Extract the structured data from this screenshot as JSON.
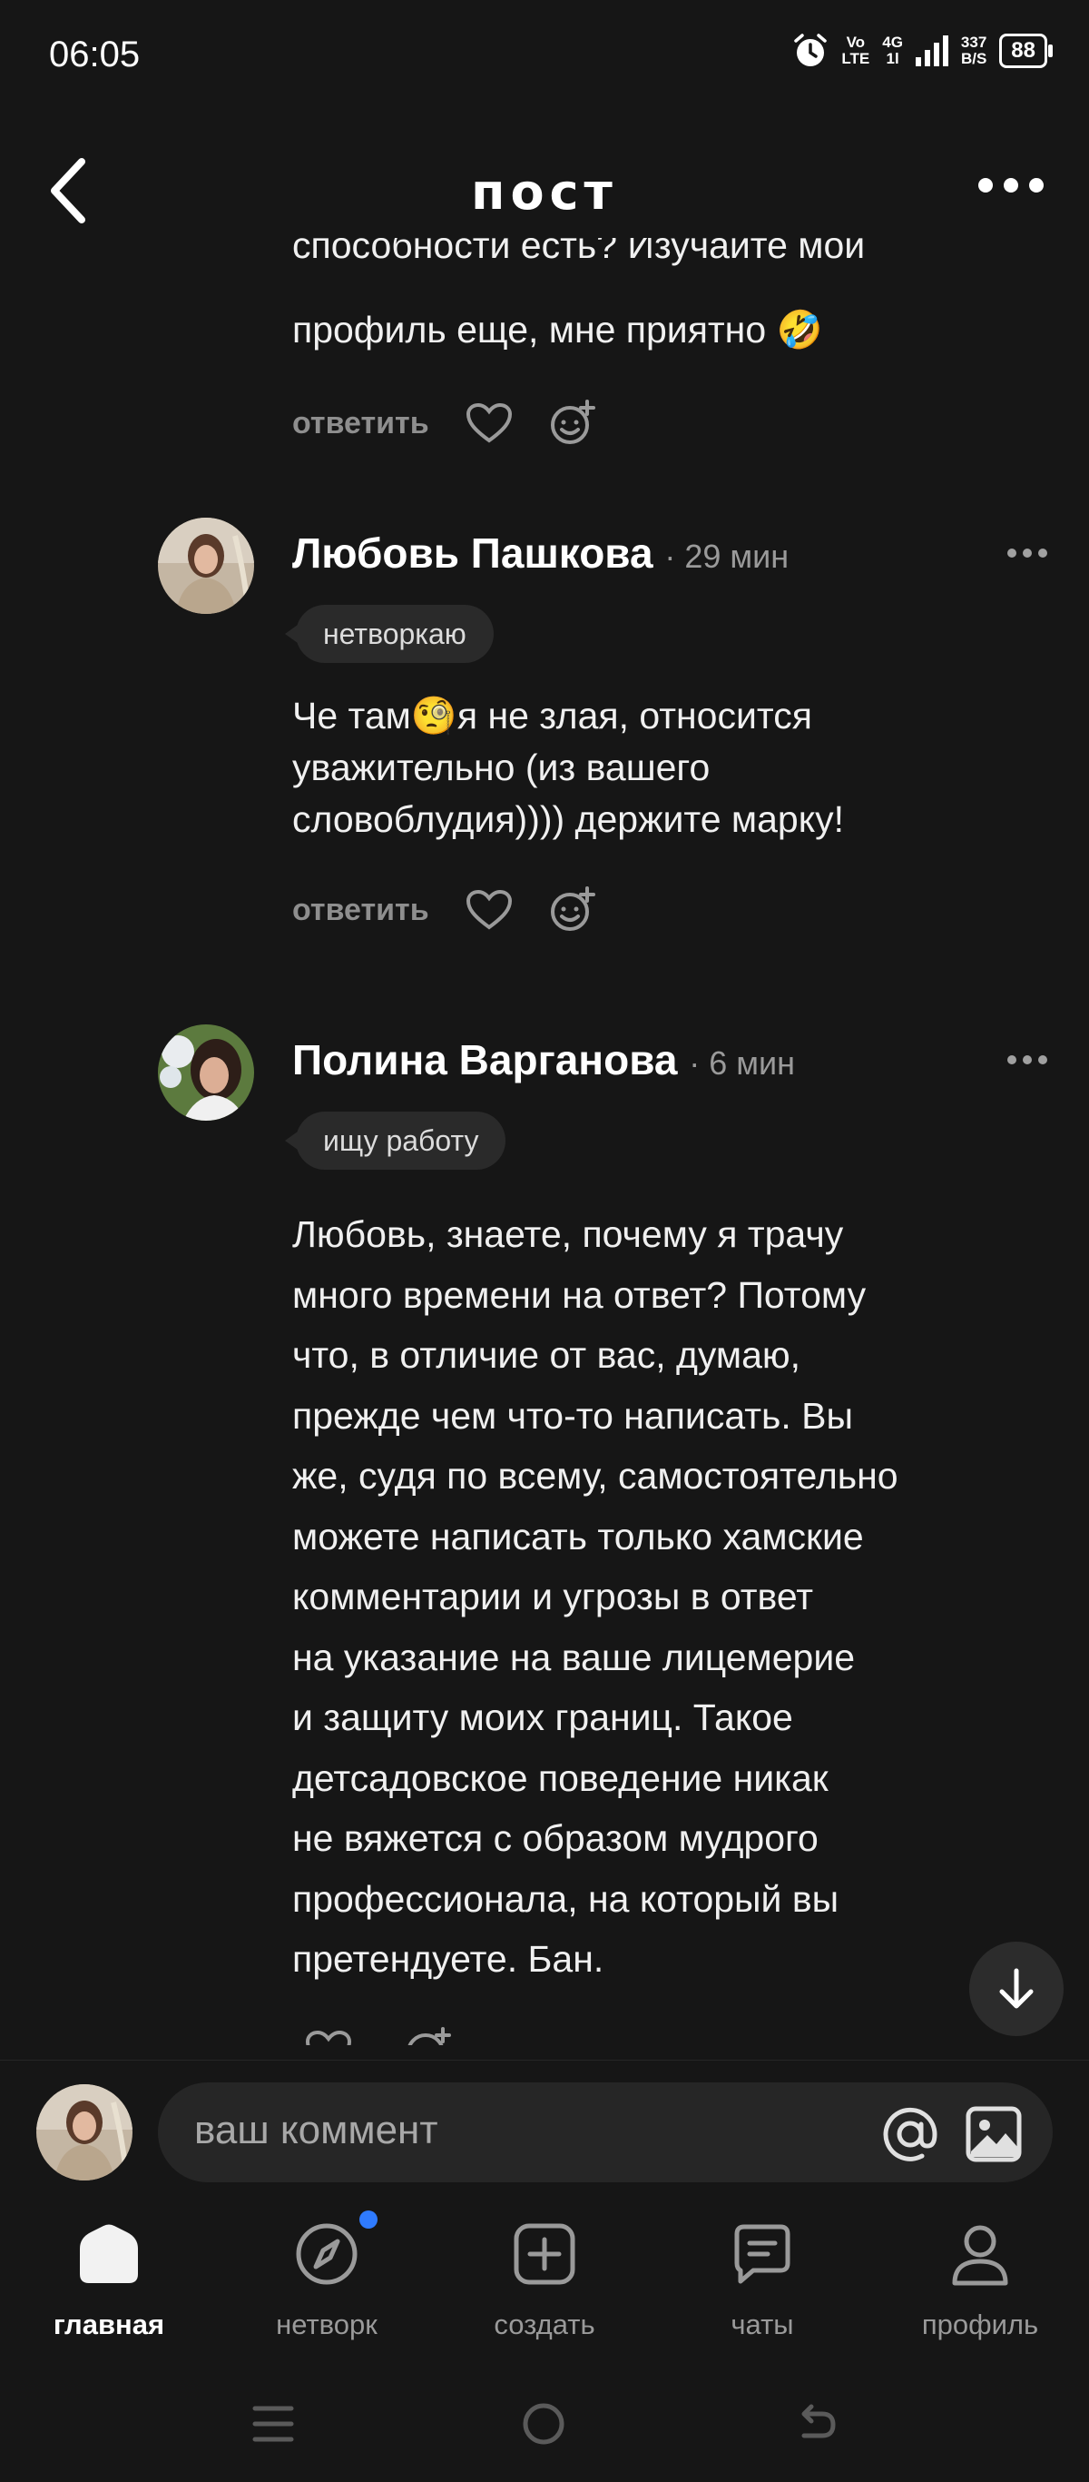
{
  "status_bar": {
    "time": "06:05",
    "volte_top": "Vo",
    "volte_bottom": "LTE",
    "network_top": "4G",
    "network_bottom": "1l",
    "speed_top": "337",
    "speed_bottom": "B/S",
    "battery": "88"
  },
  "header": {
    "title": "пост"
  },
  "partial_comment": {
    "text_line1": "способности есть? Изучайте мой",
    "text_line2": "профиль еще, мне приятно 🤣",
    "reply_label": "ответить"
  },
  "comments": [
    {
      "author": "Любовь Пашкова",
      "time": "· 29 мин",
      "tag": "нетворкаю",
      "lines": [
        "Че там🧐я не злая, относится",
        "уважительно (из вашего",
        "словоблудия)))) держите марку!"
      ],
      "reply_label": "ответить"
    },
    {
      "author": "Полина Варганова",
      "time": "· 6 мин",
      "tag": "ищу работу",
      "lines": [
        "Любовь, знаете, почему я трачу",
        "много времени на ответ? Потому",
        "что, в отличие от вас, думаю,",
        "прежде чем что-то написать. Вы",
        "же, судя по всему, самостоятельно",
        "можете написать только хамские",
        "комментарии и угрозы в ответ",
        "на указание на ваше лицемерие",
        "и защиту моих границ. Такое",
        "детсадовское поведение никак",
        "не вяжется с образом мудрого",
        "профессионала, на который вы",
        "претендуете. Бан."
      ]
    }
  ],
  "composer": {
    "placeholder": "ваш коммент"
  },
  "bottom_nav": {
    "home": "главная",
    "network": "нетворк",
    "create": "создать",
    "chats": "чаты",
    "profile": "профиль"
  },
  "colors": {
    "background": "#161616",
    "accent_dot": "#2f7bff"
  }
}
